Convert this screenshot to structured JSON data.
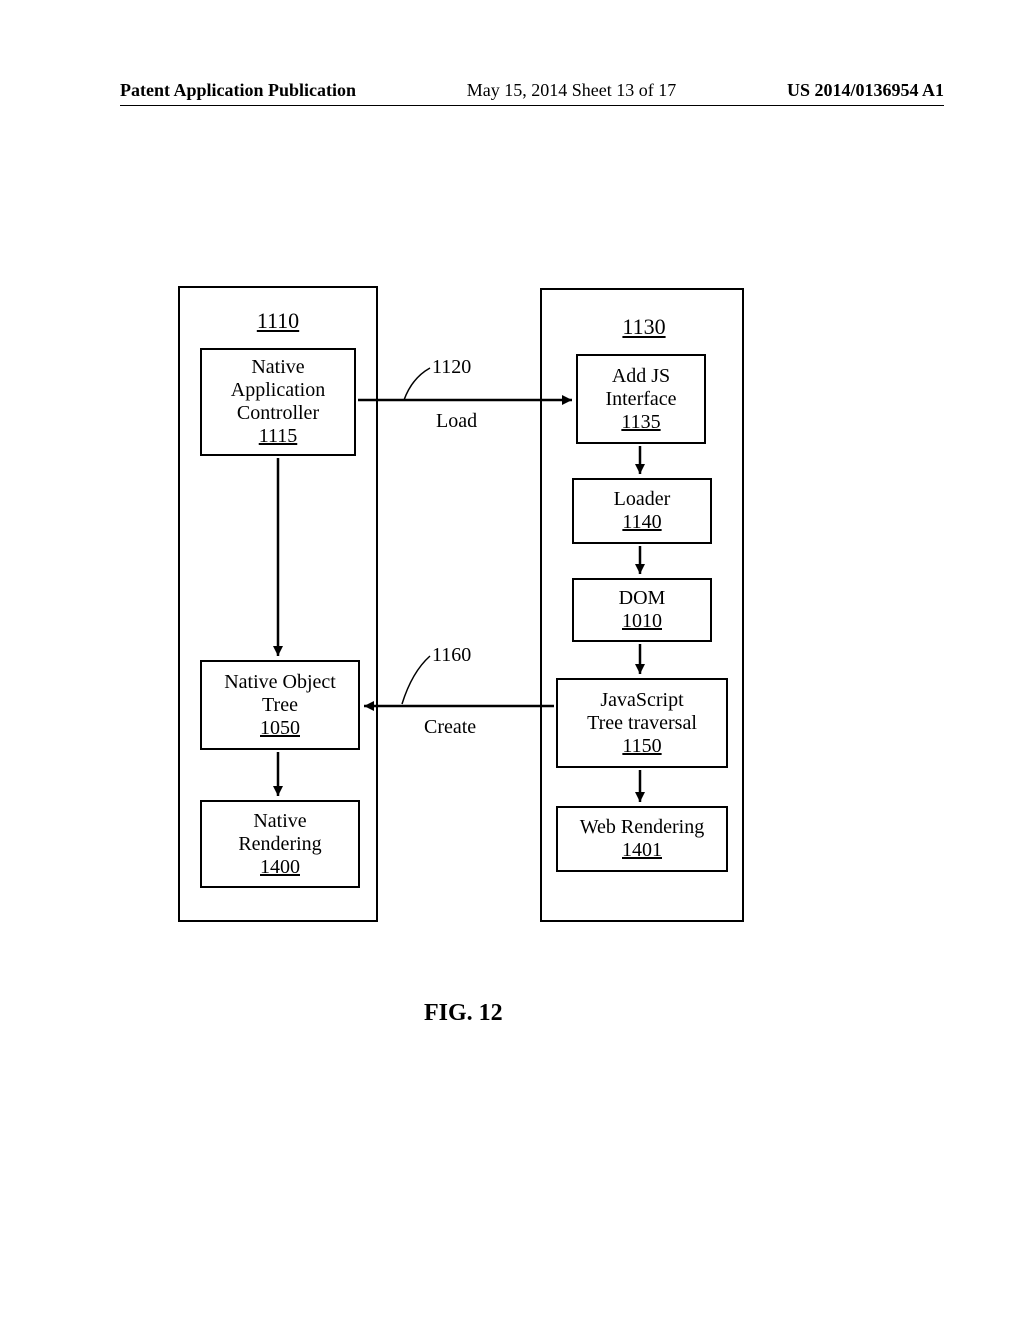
{
  "header": {
    "left": "Patent Application Publication",
    "mid": "May 15, 2014  Sheet 13 of 17",
    "right": "US 2014/0136954 A1"
  },
  "left_container_ref": "1110",
  "right_container_ref": "1130",
  "boxes": {
    "nac": {
      "lines": [
        "Native",
        "Application",
        "Controller"
      ],
      "ref": "1115"
    },
    "not": {
      "lines": [
        "Native Object",
        "Tree"
      ],
      "ref": "1050"
    },
    "nr": {
      "lines": [
        "Native",
        "Rendering"
      ],
      "ref": "1400"
    },
    "ajs": {
      "lines": [
        "Add JS",
        "Interface"
      ],
      "ref": "1135"
    },
    "ldr": {
      "lines": [
        "Loader"
      ],
      "ref": "1140"
    },
    "dom": {
      "lines": [
        "DOM"
      ],
      "ref": "1010"
    },
    "jtt": {
      "lines": [
        "JavaScript",
        "Tree traversal"
      ],
      "ref": "1150"
    },
    "wr": {
      "lines": [
        "Web Rendering"
      ],
      "ref": "1401"
    }
  },
  "arrow_labels": {
    "load": {
      "text": "Load",
      "ref": "1120"
    },
    "create": {
      "text": "Create",
      "ref": "1160"
    }
  },
  "figure_label": "FIG. 12"
}
